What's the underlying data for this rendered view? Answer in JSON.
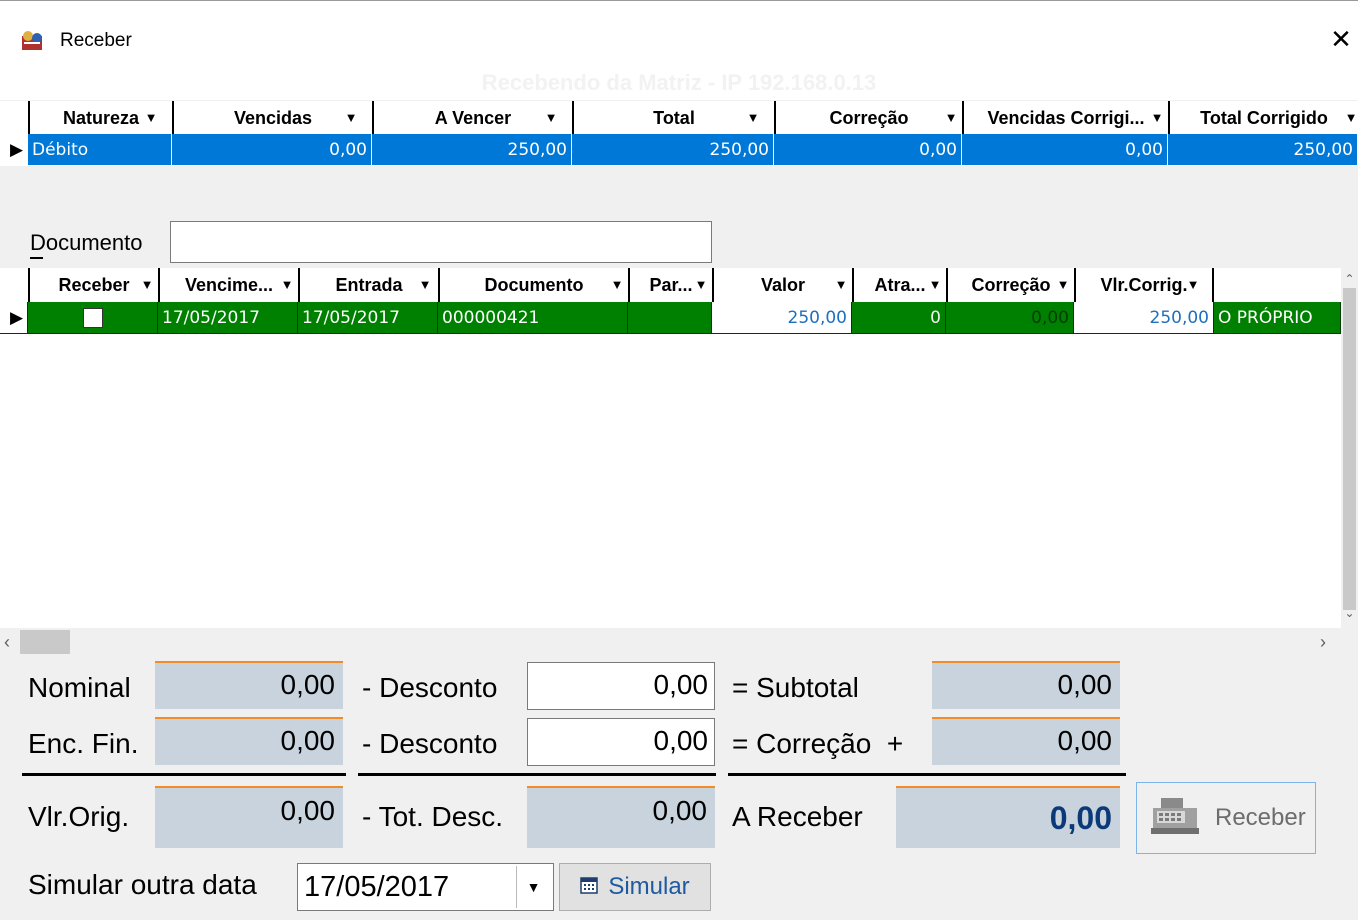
{
  "window": {
    "title": "Receber",
    "close_glyph": "✕"
  },
  "banner": "Recebendo da Matriz - IP 192.168.0.13",
  "grid1": {
    "columns": [
      "Natureza",
      "Vencidas",
      "A Vencer",
      "Total",
      "Correção",
      "Vencidas Corrigi...",
      "Total Corrigido"
    ],
    "row": [
      "Débito",
      "0,00",
      "250,00",
      "250,00",
      "0,00",
      "0,00",
      "250,00"
    ]
  },
  "documento": {
    "label": "Documento",
    "value": ""
  },
  "grid2": {
    "columns": [
      "Receber",
      "Vencime...",
      "Entrada",
      "Documento",
      "Par...",
      "Valor",
      "Atra...",
      "Correção",
      "Vlr.Corrig."
    ],
    "row": {
      "vencimento": "17/05/2017",
      "entrada": "17/05/2017",
      "documento": "000000421",
      "parcela": "",
      "valor": "250,00",
      "atraso": "0",
      "correcao": "0,00",
      "vlr_corrig": "250,00",
      "extra": "O PRÓPRIO"
    }
  },
  "totals": {
    "nominal_label": "Nominal",
    "nominal": "0,00",
    "desconto_label": "- Desconto",
    "desconto1": "0,00",
    "desconto2": "0,00",
    "subtotal_label": "= Subtotal",
    "subtotal": "0,00",
    "encfin_label": "Enc. Fin.",
    "encfin": "0,00",
    "correcao_label": "= Correção  +",
    "correcao": "0,00",
    "vlrorig_label": "Vlr.Orig.",
    "vlrorig": "0,00",
    "totdesc_label": "- Tot. Desc.",
    "totdesc": "0,00",
    "areceber_label": "A Receber",
    "areceber": "0,00"
  },
  "receber_button": "Receber",
  "simular": {
    "label": "Simular outra data",
    "date": "17/05/2017",
    "button": "Simular"
  },
  "colors": {
    "selected_row": "#0078d7",
    "green_row": "#008000",
    "static_box": "#c9d3dd",
    "accent_line": "#f28c28"
  }
}
